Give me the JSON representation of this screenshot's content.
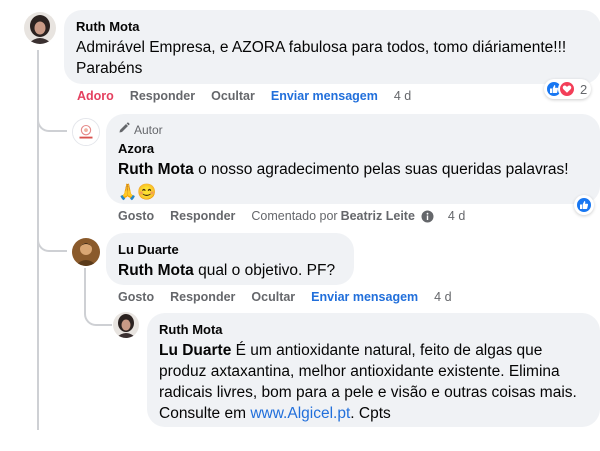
{
  "comments": [
    {
      "author": "Ruth Mota",
      "text": "Admirável Empresa, e AZORA fabulosa para todos, tomo diáriamente!!! Parabéns",
      "actions": {
        "like": "Adoro",
        "reply": "Responder",
        "hide": "Ocultar",
        "message": "Enviar mensagem",
        "time": "4 d"
      },
      "reaction_count": "2",
      "reaction_icons": [
        "like-icon",
        "love-icon"
      ]
    },
    {
      "badge_icon": "pencil-icon",
      "badge": "Autor",
      "author": "Azora",
      "mention": "Ruth Mota",
      "text": " o nosso agradecimento pelas suas queridas palavras!",
      "emoji": "🙏😊",
      "actions": {
        "like": "Gosto",
        "reply": "Responder",
        "commented_by": "Comentado por",
        "commented_name": "Beatriz Leite",
        "info_icon": "info-icon",
        "time": "4 d"
      },
      "reaction_icons": [
        "like-icon"
      ],
      "avatar_logo": "AZORA"
    },
    {
      "author": "Lu Duarte",
      "mention": "Ruth Mota",
      "text": " qual o objetivo. PF?",
      "actions": {
        "like": "Gosto",
        "reply": "Responder",
        "hide": "Ocultar",
        "message": "Enviar mensagem",
        "time": "4 d"
      }
    },
    {
      "author": "Ruth Mota",
      "mention": "Lu Duarte",
      "text": " É um antioxidante natural, feito de algas que produz axtaxantina, melhor antioxidante existente. Elimina radicais livres, bom para a pele e visão e outras coisas mais. Consulte em ",
      "link": "www.Algicel.pt",
      "text_after": ". Cpts"
    }
  ],
  "colors": {
    "like_active": "#e4405f",
    "link": "#216fdb",
    "bubble": "#f0f2f5",
    "meta": "#65676b"
  }
}
